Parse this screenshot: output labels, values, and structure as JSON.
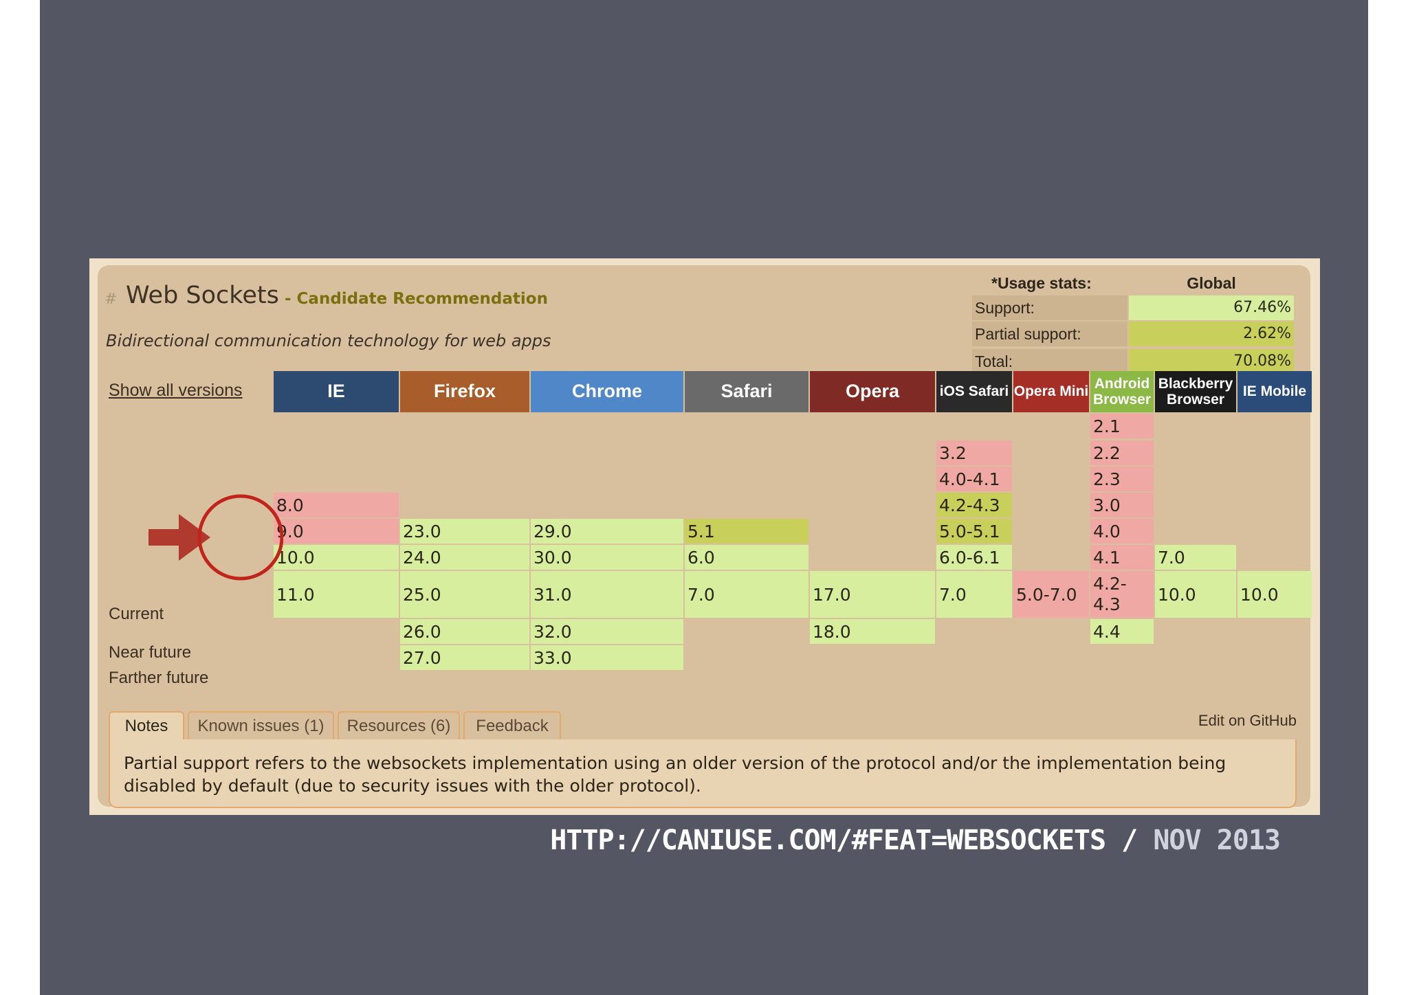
{
  "feature": {
    "hash": "#",
    "title": "Web Sockets",
    "status": "- Candidate Recommendation",
    "description": "Bidirectional communication technology for web apps"
  },
  "usage": {
    "heading": "*Usage stats:",
    "scope": "Global",
    "rows": [
      {
        "label": "Support:",
        "value": "67.46%",
        "color": "#d6ee9d"
      },
      {
        "label": "Partial support:",
        "value": "2.62%",
        "color": "#c8cf5a"
      },
      {
        "label": "Total:",
        "value": "70.08%",
        "color": "#c8cf5a"
      }
    ]
  },
  "show_all": "Show all versions",
  "browsers": [
    {
      "name": "IE",
      "color": "#2d4a70"
    },
    {
      "name": "Firefox",
      "color": "#a85d2a"
    },
    {
      "name": "Chrome",
      "color": "#4f87c9"
    },
    {
      "name": "Safari",
      "color": "#6a6a6a"
    },
    {
      "name": "Opera",
      "color": "#7f2a24"
    },
    {
      "name": "iOS Safari",
      "color": "#2a2a2a"
    },
    {
      "name": "Opera Mini",
      "color": "#a52f26"
    },
    {
      "name": "Android Browser",
      "color": "#8cb846"
    },
    {
      "name": "Blackberry Browser",
      "color": "#1b1b1b"
    },
    {
      "name": "IE Mobile",
      "color": "#2b4b78"
    }
  ],
  "row_labels": {
    "current": "Current",
    "near": "Near future",
    "farther": "Farther future"
  },
  "support_colors": {
    "yes": "#d6ee9d",
    "no": "#f0a8a4",
    "partial": "#c8cf5a"
  },
  "versions": {
    "ie": [
      {
        "v": "8.0",
        "s": "no"
      },
      {
        "v": "9.0",
        "s": "no"
      },
      {
        "v": "10.0",
        "s": "yes"
      },
      {
        "v": "11.0",
        "s": "yes"
      }
    ],
    "firefox": [
      {
        "v": "23.0",
        "s": "yes"
      },
      {
        "v": "24.0",
        "s": "yes"
      },
      {
        "v": "25.0",
        "s": "yes"
      },
      {
        "v": "26.0",
        "s": "yes"
      },
      {
        "v": "27.0",
        "s": "yes"
      }
    ],
    "chrome": [
      {
        "v": "29.0",
        "s": "yes"
      },
      {
        "v": "30.0",
        "s": "yes"
      },
      {
        "v": "31.0",
        "s": "yes"
      },
      {
        "v": "32.0",
        "s": "yes"
      },
      {
        "v": "33.0",
        "s": "yes"
      }
    ],
    "safari": [
      {
        "v": "5.1",
        "s": "partial"
      },
      {
        "v": "6.0",
        "s": "yes"
      },
      {
        "v": "7.0",
        "s": "yes"
      }
    ],
    "opera": [
      {
        "v": "17.0",
        "s": "yes"
      },
      {
        "v": "18.0",
        "s": "yes"
      }
    ],
    "ios_safari": [
      {
        "v": "3.2",
        "s": "no"
      },
      {
        "v": "4.0-4.1",
        "s": "no"
      },
      {
        "v": "4.2-4.3",
        "s": "partial"
      },
      {
        "v": "5.0-5.1",
        "s": "partial"
      },
      {
        "v": "6.0-6.1",
        "s": "yes"
      },
      {
        "v": "7.0",
        "s": "yes"
      }
    ],
    "opera_mini": [
      {
        "v": "5.0-7.0",
        "s": "no"
      }
    ],
    "android": [
      {
        "v": "2.1",
        "s": "no"
      },
      {
        "v": "2.2",
        "s": "no"
      },
      {
        "v": "2.3",
        "s": "no"
      },
      {
        "v": "3.0",
        "s": "no"
      },
      {
        "v": "4.0",
        "s": "no"
      },
      {
        "v": "4.1",
        "s": "no"
      },
      {
        "v": "4.2-4.3",
        "s": "no"
      },
      {
        "v": "4.4",
        "s": "yes"
      }
    ],
    "blackberry": [
      {
        "v": "7.0",
        "s": "yes"
      },
      {
        "v": "10.0",
        "s": "yes"
      }
    ],
    "ie_mobile": [
      {
        "v": "10.0",
        "s": "yes"
      }
    ]
  },
  "tabs": [
    {
      "label": "Notes",
      "active": true
    },
    {
      "label": "Known issues (1)",
      "active": false
    },
    {
      "label": "Resources (6)",
      "active": false
    },
    {
      "label": "Feedback",
      "active": false
    }
  ],
  "edit_link": "Edit on GitHub",
  "notes_text": "Partial support refers to the websockets implementation using an older version of the protocol and/or the implementation being disabled by default (due to security issues with the older protocol).",
  "caption": {
    "url": "HTTP://CANIUSE.COM/#FEAT=WEBSOCKETS",
    "sep": " / ",
    "date": "NOV 2013"
  },
  "annotation_colors": {
    "circle": "#c0241b",
    "arrow": "#b03a2e"
  }
}
